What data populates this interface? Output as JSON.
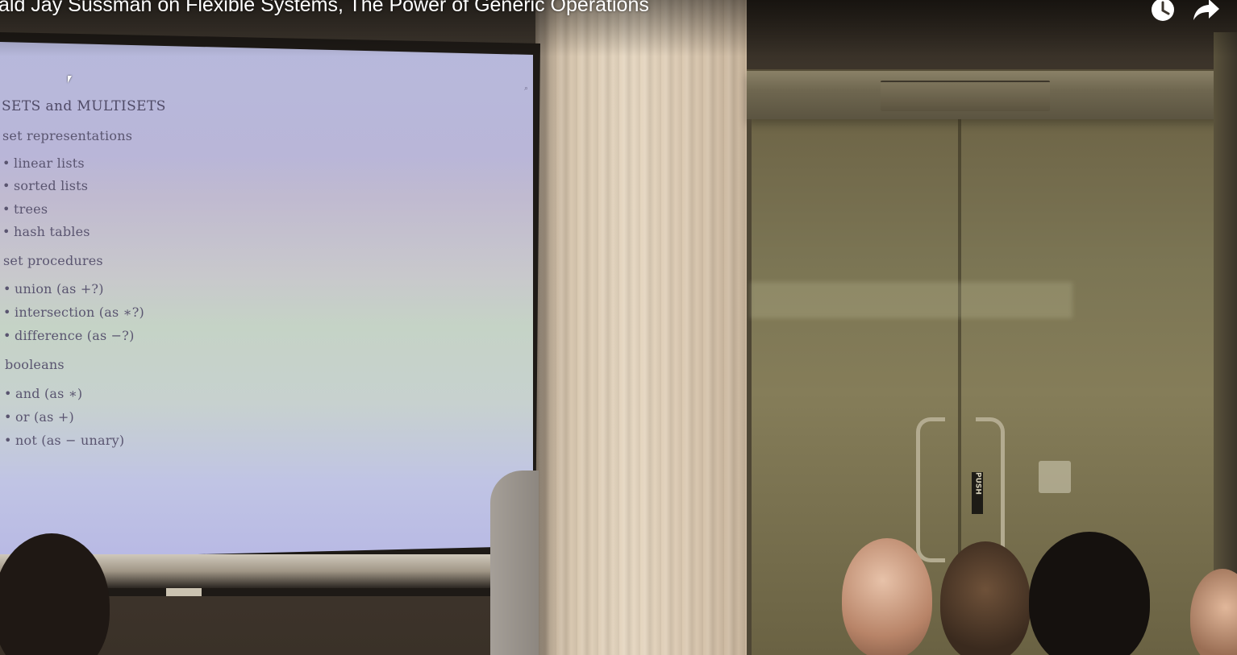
{
  "video": {
    "title": "ald Jay Sussman on Flexible Systems, The Power of Generic Operations"
  },
  "overlay_buttons": {
    "watch_later_icon": "clock-icon",
    "share_icon": "share-arrow-icon"
  },
  "slide": {
    "heading": "SETS and MULTISETS",
    "sections": [
      {
        "title": "set representations",
        "items": [
          "linear lists",
          "sorted lists",
          "trees",
          "hash tables"
        ]
      },
      {
        "title": "set procedures",
        "items": [
          "union (as +?)",
          "intersection (as ∗?)",
          "difference (as −?)"
        ]
      },
      {
        "title": "booleans",
        "items": [
          "and (as ∗)",
          "or (as +)",
          "not (as − unary)"
        ]
      }
    ]
  },
  "scene": {
    "door_label": "PUSH"
  },
  "colors": {
    "title_text": "#ffffff",
    "slide_text": "#5a5570"
  }
}
